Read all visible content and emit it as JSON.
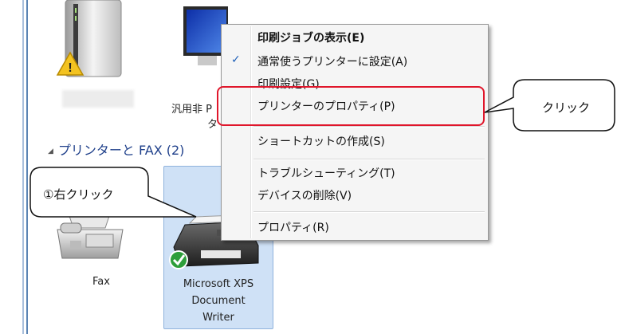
{
  "devices_top": {
    "monitor_label_line1": "汎用非 P",
    "monitor_label_line2": "タ"
  },
  "section_header": "プリンターと FAX (2)",
  "devices": [
    {
      "label": "Fax"
    },
    {
      "label_lines": [
        "Microsoft XPS",
        "Document",
        "Writer"
      ]
    }
  ],
  "context_menu": {
    "items": [
      {
        "label": "印刷ジョブの表示(E)",
        "bold": true
      },
      {
        "label": "通常使うプリンターに設定(A)",
        "checked": true
      },
      {
        "label": "印刷設定(G)"
      },
      {
        "label": "プリンターのプロパティ(P)",
        "highlighted": true
      },
      {
        "label": "ショートカットの作成(S)"
      },
      {
        "label": "トラブルシューティング(T)"
      },
      {
        "label": "デバイスの削除(V)"
      },
      {
        "label": "プロパティ(R)"
      }
    ],
    "check_glyph": "✓"
  },
  "callouts": {
    "step1": "①右クリック",
    "click": "クリック"
  },
  "colors": {
    "highlight_border": "#e0162b",
    "tile_selected": "#cfe1f6",
    "header_blue": "#1e3f8a"
  }
}
